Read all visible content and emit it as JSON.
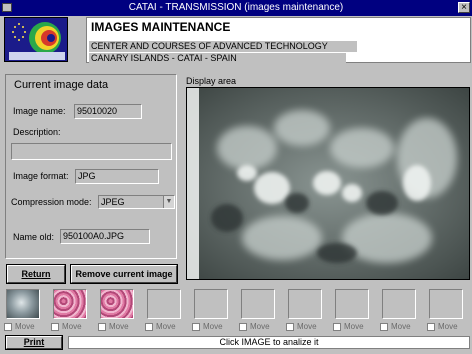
{
  "window": {
    "title": "CATAI - TRANSMISSION (images maintenance)"
  },
  "header": {
    "title": "IMAGES MAINTENANCE",
    "line1": "CENTER AND COURSES OF ADVANCED TECHNOLOGY",
    "line2": "CANARY ISLANDS - CATAI - SPAIN"
  },
  "current_image": {
    "title": "Current image data",
    "image_name_label": "Image name:",
    "image_name": "95010020",
    "description_label": "Description:",
    "description": "",
    "image_format_label": "Image format:",
    "image_format": "JPG",
    "compression_label": "Compression mode:",
    "compression": "JPEG",
    "name_old_label": "Name old:",
    "name_old": "950100A0.JPG"
  },
  "display": {
    "label": "Display area"
  },
  "buttons": {
    "return": "Return",
    "remove": "Remove current image",
    "print": "Print"
  },
  "thumbnails": {
    "move_label": "Move",
    "slots": [
      {
        "filled": true,
        "kind": "xray"
      },
      {
        "filled": true,
        "kind": "pink"
      },
      {
        "filled": true,
        "kind": "pink"
      },
      {
        "filled": false
      },
      {
        "filled": false
      },
      {
        "filled": false
      },
      {
        "filled": false
      },
      {
        "filled": false
      },
      {
        "filled": false
      },
      {
        "filled": false
      }
    ]
  },
  "status": {
    "text": "Click IMAGE to analize it"
  }
}
